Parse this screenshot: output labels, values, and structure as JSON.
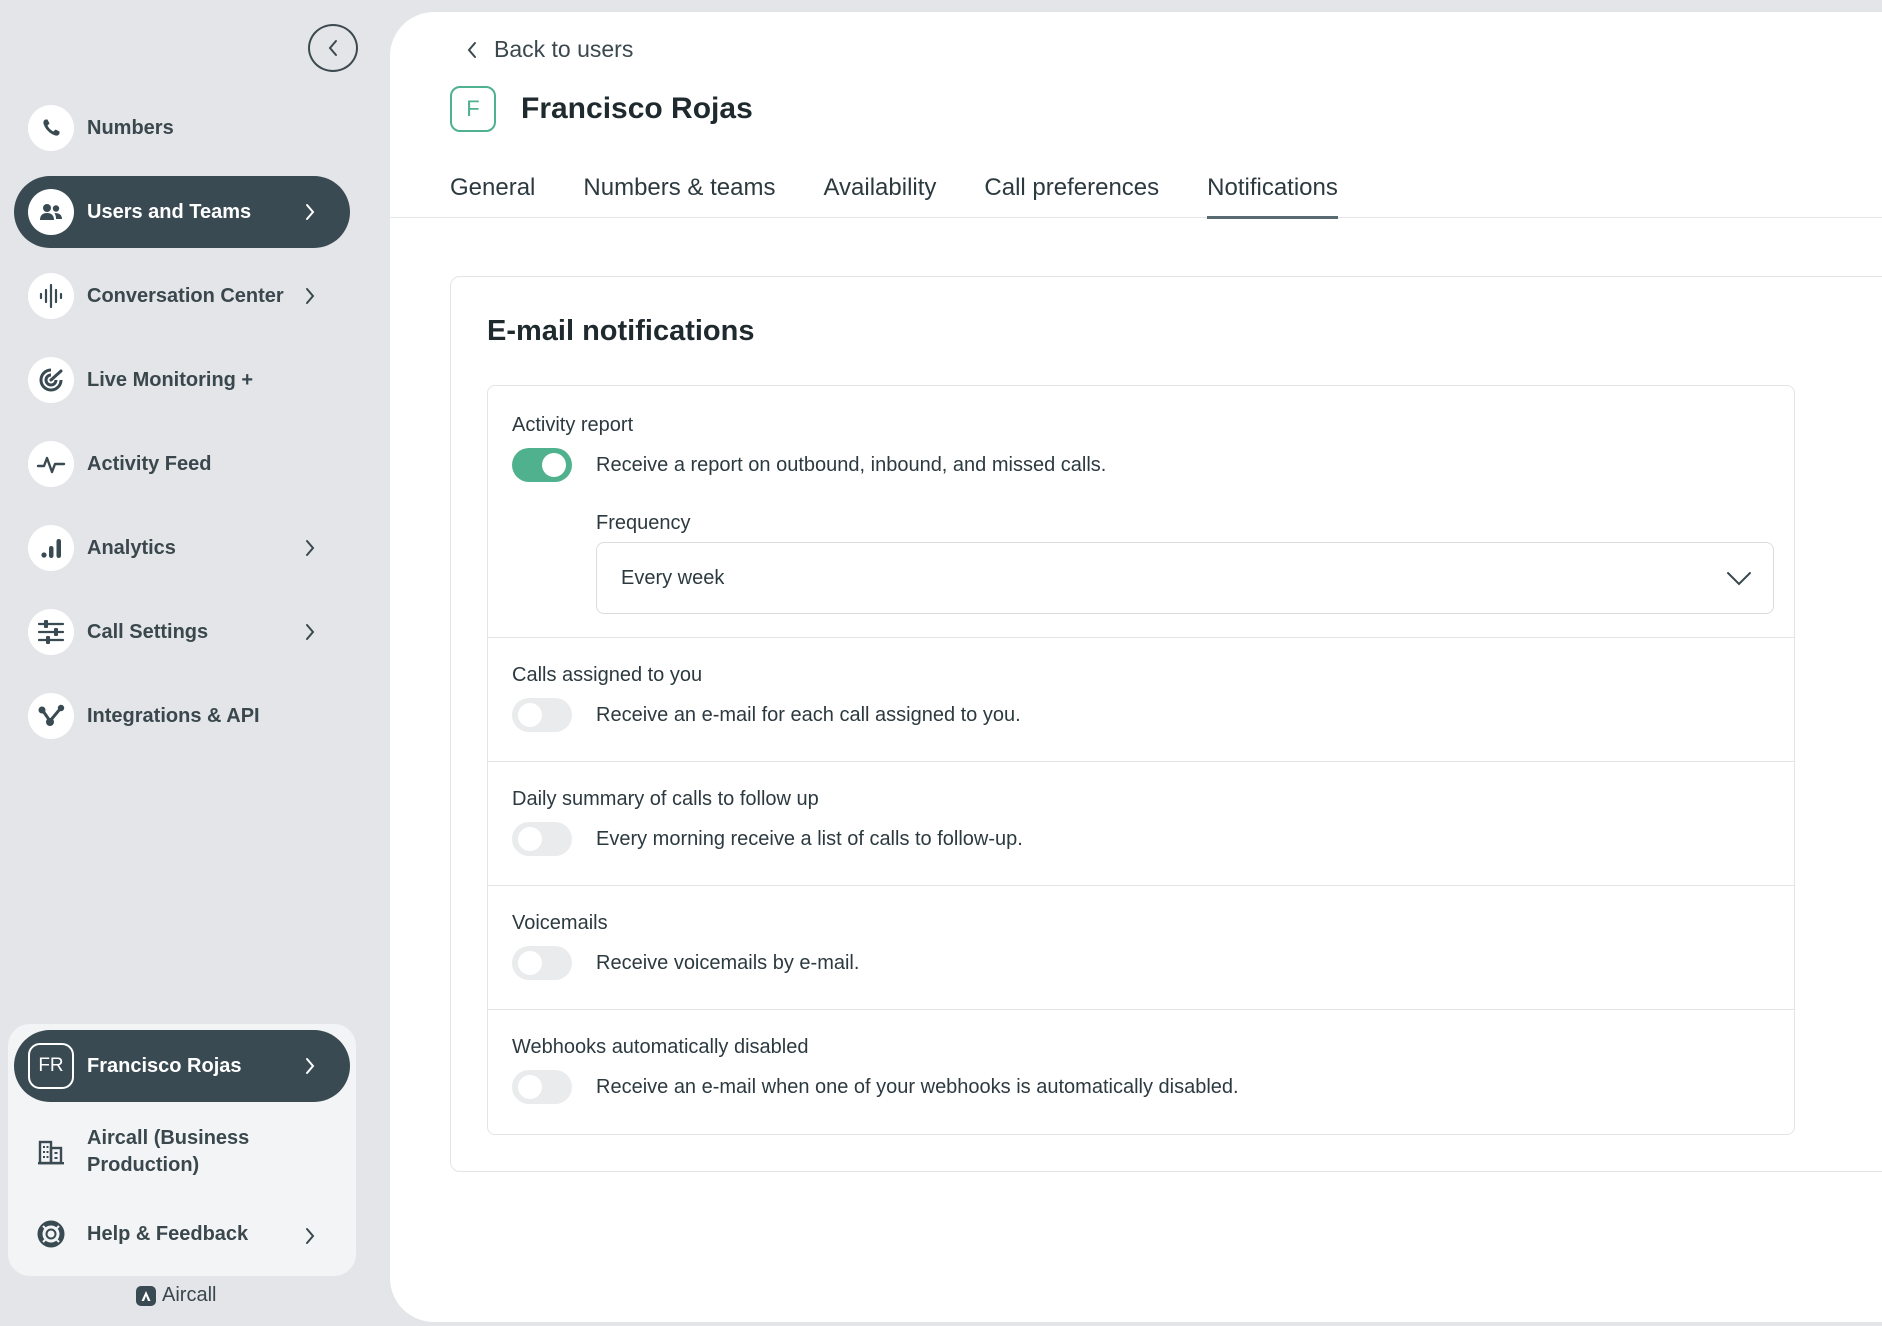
{
  "sidebar": {
    "items": [
      {
        "label": "Numbers",
        "icon": "phone-icon"
      },
      {
        "label": "Users and Teams",
        "icon": "users-icon",
        "active": true
      },
      {
        "label": "Conversation Center",
        "icon": "waveform-icon"
      },
      {
        "label": "Live Monitoring +",
        "icon": "monitoring-icon"
      },
      {
        "label": "Activity Feed",
        "icon": "pulse-icon"
      },
      {
        "label": "Analytics",
        "icon": "bar-chart-icon"
      },
      {
        "label": "Call Settings",
        "icon": "sliders-icon"
      },
      {
        "label": "Integrations & API",
        "icon": "integrations-icon"
      }
    ],
    "user": {
      "initials": "FR",
      "name": "Francisco Rojas"
    },
    "org": {
      "line1": "Aircall (Business",
      "line2": "Production)"
    },
    "help": {
      "label": "Help & Feedback"
    },
    "brand": "Aircall"
  },
  "main": {
    "back_label": "Back to users",
    "user_initial": "F",
    "user_name": "Francisco Rojas",
    "tabs": [
      {
        "label": "General"
      },
      {
        "label": "Numbers & teams"
      },
      {
        "label": "Availability"
      },
      {
        "label": "Call preferences"
      },
      {
        "label": "Notifications",
        "active": true
      }
    ],
    "section_title": "E-mail notifications",
    "notifications": [
      {
        "title": "Activity report",
        "description": "Receive a report on outbound, inbound, and missed calls.",
        "enabled": true,
        "frequency_label": "Frequency",
        "frequency_value": "Every week"
      },
      {
        "title": "Calls assigned to you",
        "description": "Receive an e-mail for each call assigned to you.",
        "enabled": false
      },
      {
        "title": "Daily summary of calls to follow up",
        "description": "Every morning receive a list of calls to follow-up.",
        "enabled": false
      },
      {
        "title": "Voicemails",
        "description": "Receive voicemails by e-mail.",
        "enabled": false
      },
      {
        "title": "Webhooks automatically disabled",
        "description": "Receive an e-mail when one of your webhooks is automatically disabled.",
        "enabled": false
      }
    ]
  },
  "colors": {
    "accent": "#4fb18d",
    "nav_active": "#3a4a52",
    "sidebar_bg": "#e3e5e8"
  }
}
